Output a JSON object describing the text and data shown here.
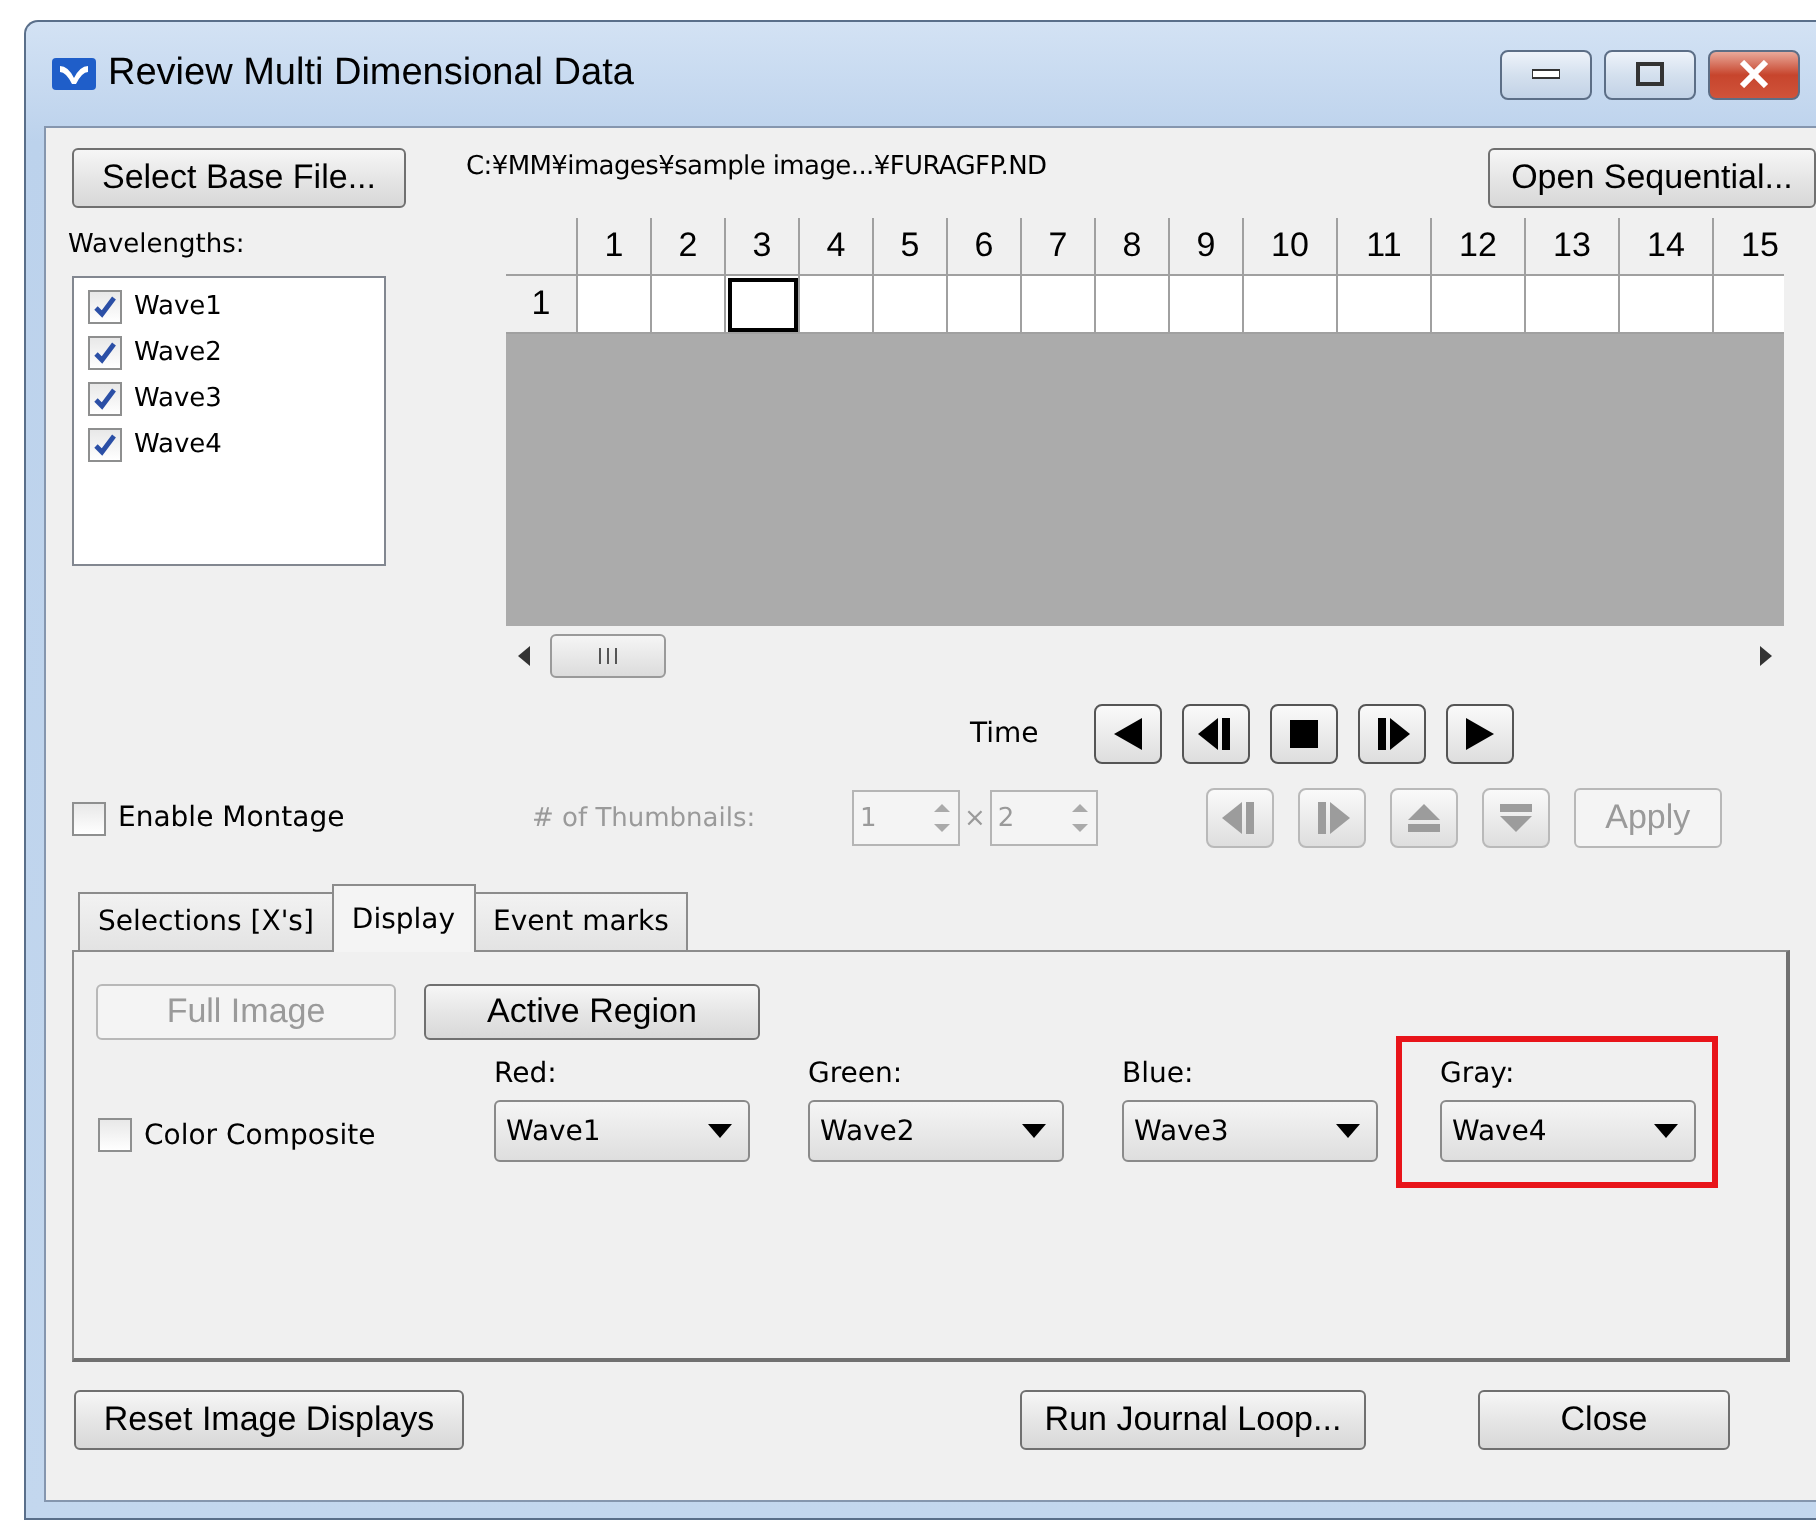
{
  "window": {
    "title": "Review Multi Dimensional Data"
  },
  "select_base_file_button": "Select Base File...",
  "file_path": "C:¥MM¥images¥sample image...¥FURAGFP.ND",
  "open_sequential_button": "Open Sequential...",
  "wavelengths": {
    "label": "Wavelengths:",
    "items": [
      {
        "label": "Wave1",
        "checked": true
      },
      {
        "label": "Wave2",
        "checked": true
      },
      {
        "label": "Wave3",
        "checked": true
      },
      {
        "label": "Wave4",
        "checked": true
      }
    ]
  },
  "grid": {
    "columns": [
      "1",
      "2",
      "3",
      "4",
      "5",
      "6",
      "7",
      "8",
      "9",
      "10",
      "11",
      "12",
      "13",
      "14",
      "15"
    ],
    "rows": [
      {
        "label": "1",
        "cells": [
          {
            "selected": false
          },
          {
            "selected": false
          },
          {
            "selected": true
          },
          {
            "selected": false
          },
          {
            "selected": false
          },
          {
            "selected": false
          },
          {
            "selected": false
          },
          {
            "selected": false
          },
          {
            "selected": false
          },
          {
            "selected": false
          },
          {
            "selected": false
          },
          {
            "selected": false
          },
          {
            "selected": false
          },
          {
            "selected": false
          },
          {
            "selected": false
          }
        ]
      }
    ]
  },
  "time": {
    "label": "Time",
    "buttons": [
      {
        "kind": "first"
      },
      {
        "kind": "back"
      },
      {
        "kind": "stop"
      },
      {
        "kind": "forward"
      },
      {
        "kind": "last"
      }
    ]
  },
  "montage": {
    "enable": {
      "label": "Enable Montage",
      "checked": false
    },
    "thumbnails_label": "# of Thumbnails:",
    "disabled": true,
    "rows": "1",
    "times": "×",
    "cols": "2",
    "buttons": [
      {
        "kind": "back"
      },
      {
        "kind": "forward"
      },
      {
        "kind": "up"
      },
      {
        "kind": "down"
      }
    ],
    "apply_button": "Apply"
  },
  "tabs": [
    {
      "label": "Selections [X's]",
      "selected": false
    },
    {
      "label": "Display",
      "selected": true
    },
    {
      "label": "Event marks",
      "selected": false
    }
  ],
  "display": {
    "full_image": {
      "label": "Full Image",
      "disabled": true
    },
    "active_region": {
      "label": "Active Region",
      "disabled": false
    },
    "color_composite": {
      "label": "Color Composite",
      "checked": false
    },
    "channels": [
      {
        "label": "Red:",
        "value": "Wave1",
        "highlighted": false
      },
      {
        "label": "Green:",
        "value": "Wave2",
        "highlighted": false
      },
      {
        "label": "Blue:",
        "value": "Wave3",
        "highlighted": false
      },
      {
        "label": "Gray:",
        "value": "Wave4",
        "highlighted": true
      }
    ]
  },
  "bottom_buttons": [
    "Reset Image Displays",
    "Run Journal Loop...",
    "Close"
  ]
}
